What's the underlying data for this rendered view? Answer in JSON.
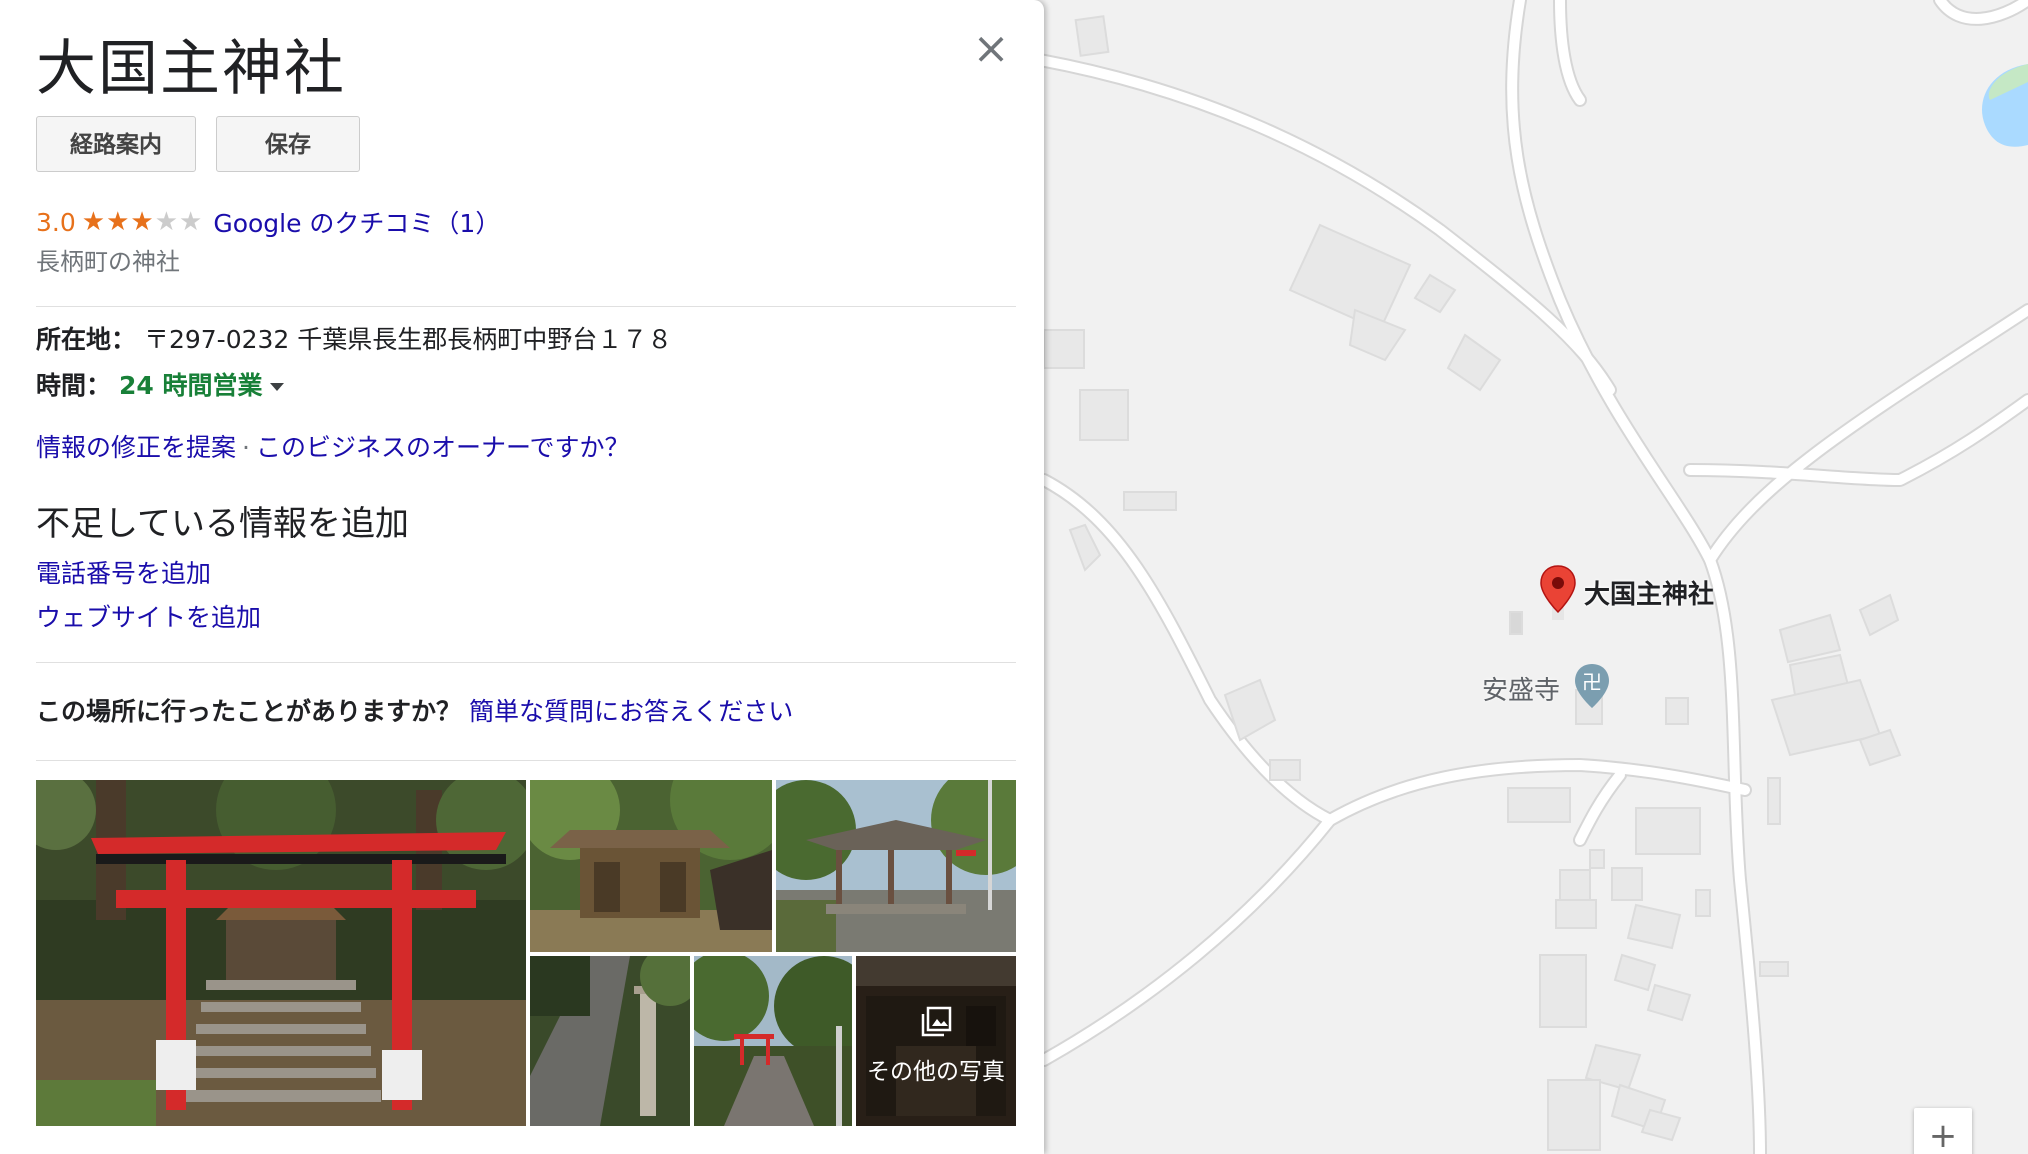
{
  "place": {
    "title": "大国主神社",
    "close_symbol": "×"
  },
  "actions": {
    "route_label": "経路案内",
    "save_label": "保存"
  },
  "rating": {
    "value": "3.0",
    "stars": 3,
    "max_stars": 5,
    "reviews_label": "Google のクチコミ（1）",
    "category": "長柄町の神社"
  },
  "info": {
    "address_label": "所在地：",
    "address_value": "〒297-0232 千葉県長生郡長柄町中野台１７８",
    "hours_label": "時間：",
    "hours_value": "24 時間営業"
  },
  "links": {
    "suggest_edit": "情報の修正を提案",
    "separator": "·",
    "owner": "このビジネスのオーナーですか？"
  },
  "missing_info": {
    "heading": "不足している情報を追加",
    "add_phone": "電話番号を追加",
    "add_website": "ウェブサイトを追加"
  },
  "visited": {
    "question": "この場所に行ったことがありますか？",
    "answer_link": "簡単な質問にお答えください"
  },
  "photos": {
    "more_label": "その他の写真"
  },
  "map": {
    "pin_label": "大国主神社",
    "poi_label": "安盛寺",
    "poi_symbol": "卍",
    "zoom_in_symbol": "+"
  },
  "colors": {
    "rating_orange": "#e7711b",
    "link_blue": "#1a0dab",
    "open_green": "#188038",
    "pin_red": "#ea4335"
  }
}
